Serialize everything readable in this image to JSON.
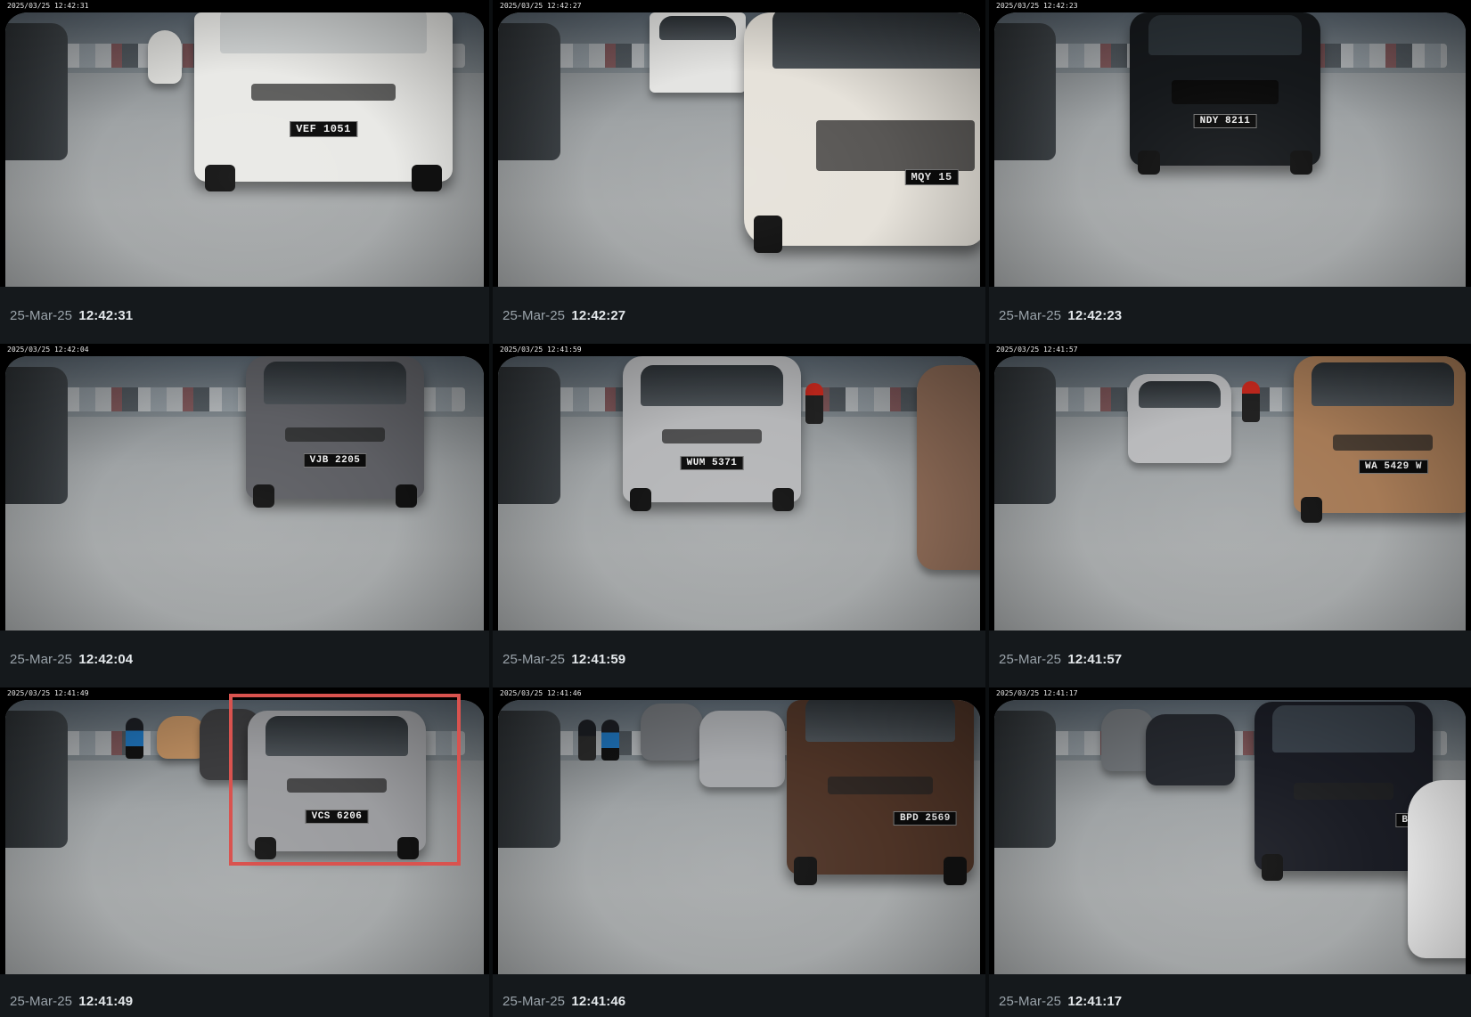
{
  "tiles": [
    {
      "osd": "2025/03/25 12:42:31",
      "date": "25-Mar-25",
      "time": "12:42:31",
      "vehicle": {
        "color": "#e9e9e6",
        "plate": "VEF 1051",
        "type": "truck"
      },
      "selected": false
    },
    {
      "osd": "2025/03/25 12:42:27",
      "date": "25-Mar-25",
      "time": "12:42:27",
      "vehicle": {
        "color": "#e6e2da",
        "plate": "MQY 15",
        "type": "van"
      },
      "selected": false
    },
    {
      "osd": "2025/03/25 12:42:23",
      "date": "25-Mar-25",
      "time": "12:42:23",
      "vehicle": {
        "color": "#15181b",
        "plate": "NDY 8211",
        "type": "suv"
      },
      "selected": false
    },
    {
      "osd": "2025/03/25 12:42:04",
      "date": "25-Mar-25",
      "time": "12:42:04",
      "vehicle": {
        "color": "#5d5e63",
        "plate": "VJB 2205",
        "type": "hatchback"
      },
      "selected": false
    },
    {
      "osd": "2025/03/25 12:41:59",
      "date": "25-Mar-25",
      "time": "12:41:59",
      "vehicle": {
        "color": "#b5b6b8",
        "plate": "WUM 5371",
        "type": "sedan"
      },
      "selected": false
    },
    {
      "osd": "2025/03/25 12:41:57",
      "date": "25-Mar-25",
      "time": "12:41:57",
      "vehicle": {
        "color": "#a57a56",
        "plate": "WA 5429 W",
        "type": "hatchback"
      },
      "selected": false
    },
    {
      "osd": "2025/03/25 12:41:49",
      "date": "25-Mar-25",
      "time": "12:41:49",
      "vehicle": {
        "color": "#9b9c9f",
        "plate": "VCS 6206",
        "type": "sedan"
      },
      "selected": true,
      "highlight_color": "#d9534f"
    },
    {
      "osd": "2025/03/25 12:41:46",
      "date": "25-Mar-25",
      "time": "12:41:46",
      "vehicle": {
        "color": "#4d3326",
        "plate": "BPD 2569",
        "type": "mpv"
      },
      "selected": false
    },
    {
      "osd": "2025/03/25 12:41:17",
      "date": "25-Mar-25",
      "time": "12:41:17",
      "vehicle": {
        "color": "#1a1c24",
        "plate": "BKJ",
        "type": "mpv"
      },
      "selected": false
    }
  ]
}
